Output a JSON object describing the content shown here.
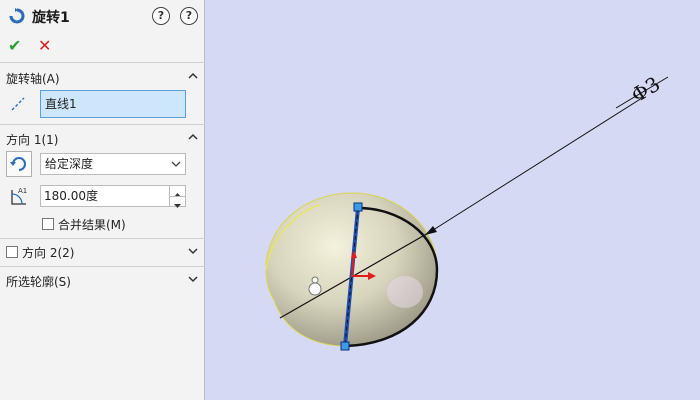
{
  "header": {
    "title": "旋转1"
  },
  "actions": {
    "ok_symbol": "✔",
    "cancel_symbol": "✕"
  },
  "sections": {
    "axis": {
      "title": "旋转轴(A)",
      "value": "直线1"
    },
    "direction1": {
      "title": "方向 1(1)",
      "end_condition": "给定深度",
      "angle": "180.00度",
      "merge_label": "合并结果(M)"
    },
    "direction2": {
      "title": "方向 2(2)"
    },
    "contours": {
      "title": "所选轮廓(S)"
    }
  },
  "viewport": {
    "dimension_label": "Φ3"
  },
  "colors": {
    "background": "#d6d9f3",
    "confirm": "#2f9d2f",
    "cancel": "#d42020",
    "selection": "#cde6fb"
  },
  "icons": [
    "revolve-feature-icon",
    "help-icon",
    "help-icon",
    "checkmark-icon",
    "close-icon",
    "line-axis-icon",
    "reverse-direction-icon",
    "angle-icon",
    "chevron-up-icon",
    "chevron-down-icon"
  ]
}
